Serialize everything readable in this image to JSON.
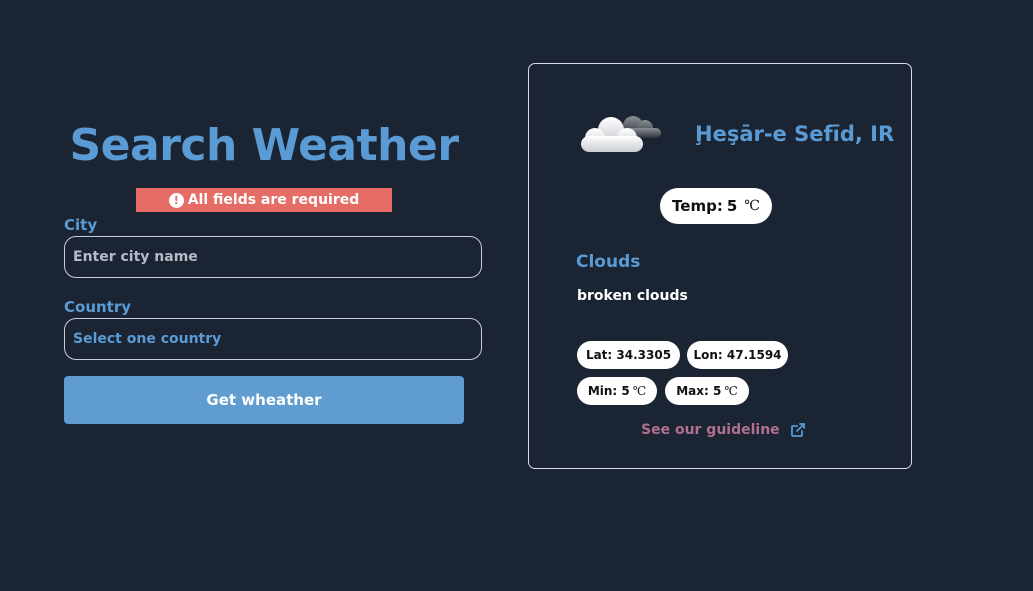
{
  "form": {
    "title": "Search Weather",
    "alert_icon": "!",
    "alert_text": "All fields are required",
    "city_label": "City",
    "city_placeholder": "Enter city name",
    "city_value": "",
    "country_label": "Country",
    "country_value": "Select one country",
    "submit_label": "Get wheather"
  },
  "weather": {
    "icon": "broken-clouds-icon",
    "city": "Ḩeşār-e Sefīd, IR",
    "temp_label": "Temp:",
    "temp_value": "5",
    "temp_unit": "℃",
    "main": "Clouds",
    "description": "broken clouds",
    "lat": "Lat: 34.3305",
    "lon": "Lon: 47.1594",
    "min_label": "Min: 5",
    "min_unit": "℃",
    "max_label": "Max: 5",
    "max_unit": "℃",
    "guideline_link": "See our guideline"
  },
  "colors": {
    "background": "#1b2432",
    "accent": "#5b9bd5",
    "alert": "#e56d66",
    "button": "#5f9ccf",
    "link": "#b0718e"
  }
}
